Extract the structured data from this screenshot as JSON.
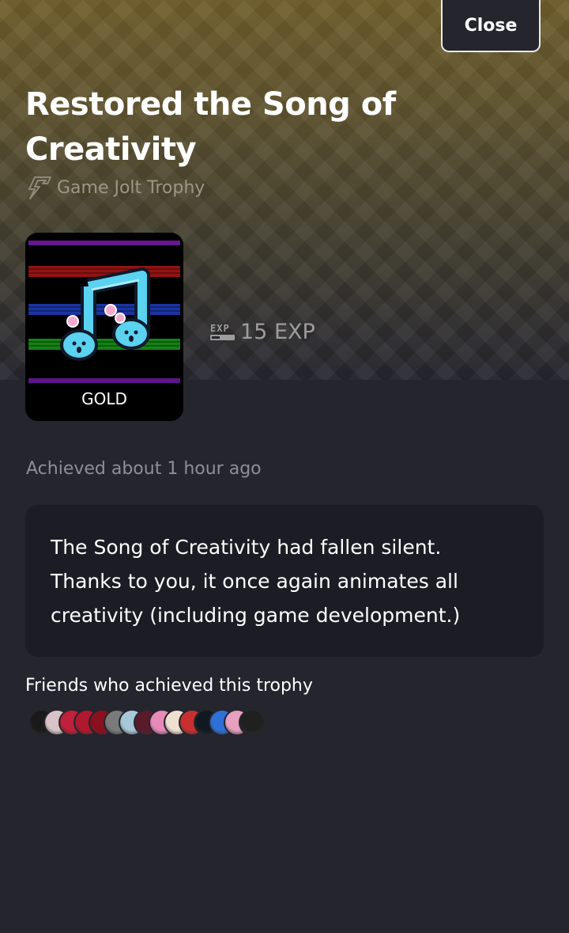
{
  "header": {
    "close_label": "Close",
    "title": "Restored the Song of Creativity",
    "subtitle": "Game Jolt Trophy"
  },
  "trophy": {
    "tier": "GOLD",
    "image_icon": "music-note-trophy-icon",
    "exp_badge": "EXP",
    "exp_label": "15 EXP"
  },
  "achieved": "Achieved about 1 hour ago",
  "description": "The Song of Creativity had fallen silent. Thanks to you, it once again animates all creativity (including game development.)",
  "friends": {
    "heading": "Friends who achieved this trophy",
    "avatars": [
      {
        "color": "#1a1a1a"
      },
      {
        "color": "#d9c3c8"
      },
      {
        "color": "#c0203a"
      },
      {
        "color": "#b0182d"
      },
      {
        "color": "#8a1020"
      },
      {
        "color": "#7a7a7a"
      },
      {
        "color": "#a8c8d8"
      },
      {
        "color": "#5a1a2a"
      },
      {
        "color": "#e88ab8"
      },
      {
        "color": "#f0e0d0"
      },
      {
        "color": "#c83030"
      },
      {
        "color": "#101820"
      },
      {
        "color": "#2f6fd8"
      },
      {
        "color": "#e8a0c0"
      },
      {
        "color": "#202020"
      }
    ]
  },
  "colors": {
    "background": "#25252e",
    "card": "#1c1c24",
    "header_gold": "#6e5d2a",
    "muted_text": "#8e8e93"
  }
}
